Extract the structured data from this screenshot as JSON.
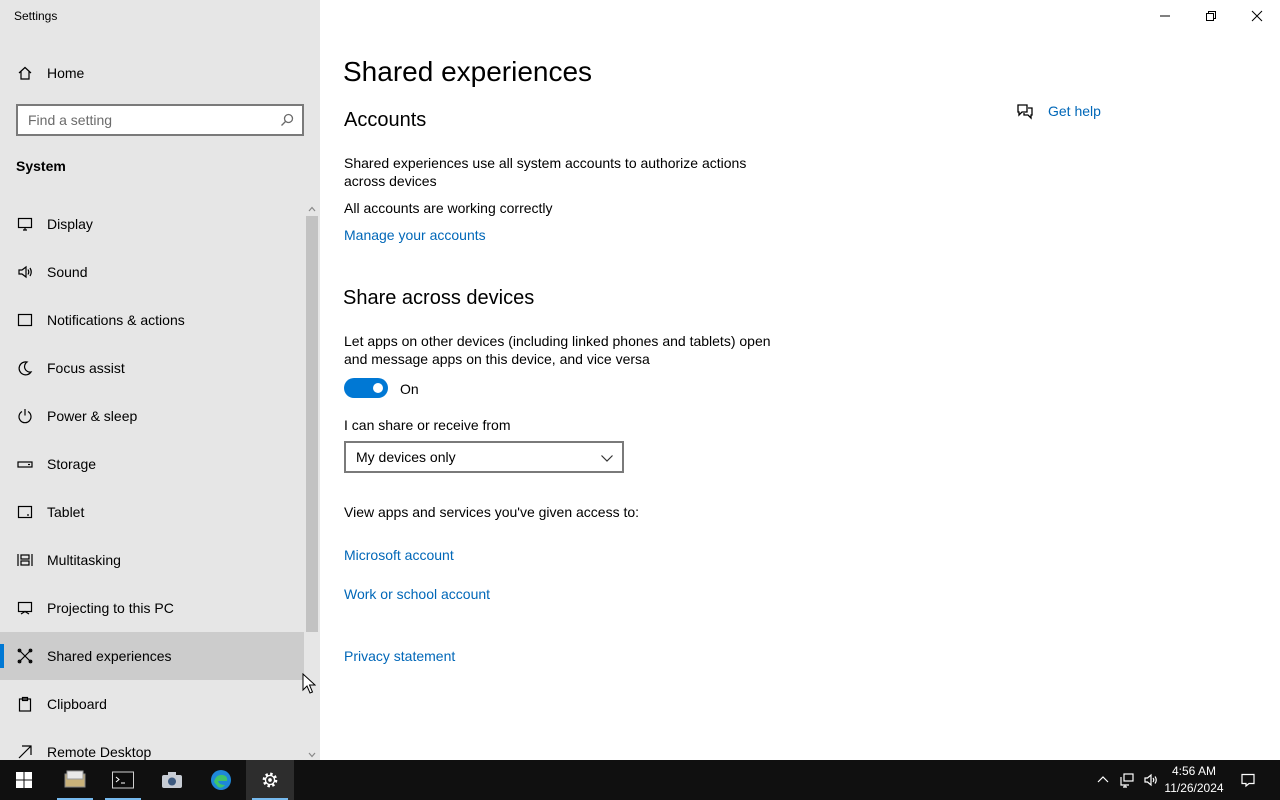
{
  "window": {
    "title": "Settings"
  },
  "sidebar": {
    "home_label": "Home",
    "search_placeholder": "Find a setting",
    "section": "System",
    "items": [
      {
        "label": "Display",
        "icon": "monitor-icon"
      },
      {
        "label": "Sound",
        "icon": "speaker-icon"
      },
      {
        "label": "Notifications & actions",
        "icon": "notification-icon"
      },
      {
        "label": "Focus assist",
        "icon": "moon-icon"
      },
      {
        "label": "Power & sleep",
        "icon": "power-icon"
      },
      {
        "label": "Storage",
        "icon": "storage-icon"
      },
      {
        "label": "Tablet",
        "icon": "tablet-icon"
      },
      {
        "label": "Multitasking",
        "icon": "multitasking-icon"
      },
      {
        "label": "Projecting to this PC",
        "icon": "projecting-icon"
      },
      {
        "label": "Shared experiences",
        "icon": "shared-experiences-icon",
        "selected": true
      },
      {
        "label": "Clipboard",
        "icon": "clipboard-icon"
      },
      {
        "label": "Remote Desktop",
        "icon": "remote-desktop-icon"
      }
    ]
  },
  "main": {
    "title": "Shared experiences",
    "get_help": "Get help",
    "accounts": {
      "heading": "Accounts",
      "description": "Shared experiences use all system accounts to authorize actions across devices",
      "status": "All accounts are working correctly",
      "manage_link": "Manage your accounts"
    },
    "share": {
      "heading": "Share across devices",
      "description": "Let apps on other devices (including linked phones and tablets) open and message apps on this device, and vice versa",
      "toggle_state": "On",
      "toggle_on": true,
      "share_from_label": "I can share or receive from",
      "share_from_value": "My devices only",
      "view_apps_label": "View apps and services you've given access to:",
      "microsoft_account_link": "Microsoft account",
      "work_school_link": "Work or school account"
    },
    "privacy_link": "Privacy statement"
  },
  "taskbar": {
    "apps": [
      "start-icon",
      "file-explorer-icon",
      "terminal-icon",
      "camera-icon",
      "edge-icon",
      "settings-icon"
    ],
    "time": "4:56 AM",
    "date": "11/26/2024"
  },
  "colors": {
    "accent": "#0078d4",
    "link": "#0067b8",
    "sidebar_bg": "#e6e6e6",
    "selected_bg": "#cccccc",
    "taskbar_bg": "#101010"
  }
}
